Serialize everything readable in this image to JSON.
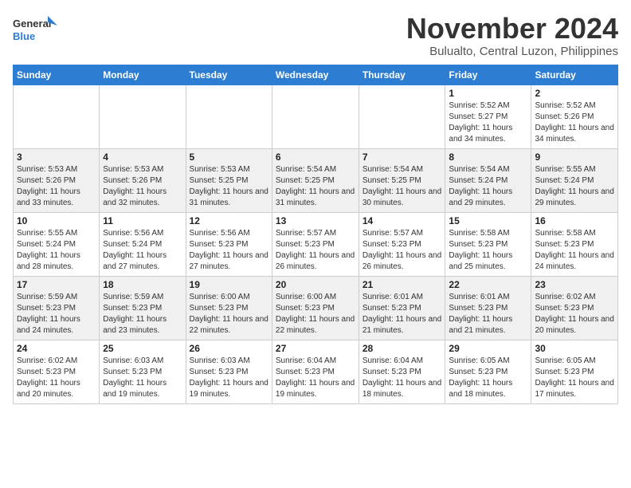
{
  "logo": {
    "line1": "General",
    "line2": "Blue"
  },
  "header": {
    "month": "November 2024",
    "location": "Bulualto, Central Luzon, Philippines"
  },
  "weekdays": [
    "Sunday",
    "Monday",
    "Tuesday",
    "Wednesday",
    "Thursday",
    "Friday",
    "Saturday"
  ],
  "weeks": [
    [
      {
        "day": "",
        "info": ""
      },
      {
        "day": "",
        "info": ""
      },
      {
        "day": "",
        "info": ""
      },
      {
        "day": "",
        "info": ""
      },
      {
        "day": "",
        "info": ""
      },
      {
        "day": "1",
        "info": "Sunrise: 5:52 AM\nSunset: 5:27 PM\nDaylight: 11 hours and 34 minutes."
      },
      {
        "day": "2",
        "info": "Sunrise: 5:52 AM\nSunset: 5:26 PM\nDaylight: 11 hours and 34 minutes."
      }
    ],
    [
      {
        "day": "3",
        "info": "Sunrise: 5:53 AM\nSunset: 5:26 PM\nDaylight: 11 hours and 33 minutes."
      },
      {
        "day": "4",
        "info": "Sunrise: 5:53 AM\nSunset: 5:26 PM\nDaylight: 11 hours and 32 minutes."
      },
      {
        "day": "5",
        "info": "Sunrise: 5:53 AM\nSunset: 5:25 PM\nDaylight: 11 hours and 31 minutes."
      },
      {
        "day": "6",
        "info": "Sunrise: 5:54 AM\nSunset: 5:25 PM\nDaylight: 11 hours and 31 minutes."
      },
      {
        "day": "7",
        "info": "Sunrise: 5:54 AM\nSunset: 5:25 PM\nDaylight: 11 hours and 30 minutes."
      },
      {
        "day": "8",
        "info": "Sunrise: 5:54 AM\nSunset: 5:24 PM\nDaylight: 11 hours and 29 minutes."
      },
      {
        "day": "9",
        "info": "Sunrise: 5:55 AM\nSunset: 5:24 PM\nDaylight: 11 hours and 29 minutes."
      }
    ],
    [
      {
        "day": "10",
        "info": "Sunrise: 5:55 AM\nSunset: 5:24 PM\nDaylight: 11 hours and 28 minutes."
      },
      {
        "day": "11",
        "info": "Sunrise: 5:56 AM\nSunset: 5:24 PM\nDaylight: 11 hours and 27 minutes."
      },
      {
        "day": "12",
        "info": "Sunrise: 5:56 AM\nSunset: 5:23 PM\nDaylight: 11 hours and 27 minutes."
      },
      {
        "day": "13",
        "info": "Sunrise: 5:57 AM\nSunset: 5:23 PM\nDaylight: 11 hours and 26 minutes."
      },
      {
        "day": "14",
        "info": "Sunrise: 5:57 AM\nSunset: 5:23 PM\nDaylight: 11 hours and 26 minutes."
      },
      {
        "day": "15",
        "info": "Sunrise: 5:58 AM\nSunset: 5:23 PM\nDaylight: 11 hours and 25 minutes."
      },
      {
        "day": "16",
        "info": "Sunrise: 5:58 AM\nSunset: 5:23 PM\nDaylight: 11 hours and 24 minutes."
      }
    ],
    [
      {
        "day": "17",
        "info": "Sunrise: 5:59 AM\nSunset: 5:23 PM\nDaylight: 11 hours and 24 minutes."
      },
      {
        "day": "18",
        "info": "Sunrise: 5:59 AM\nSunset: 5:23 PM\nDaylight: 11 hours and 23 minutes."
      },
      {
        "day": "19",
        "info": "Sunrise: 6:00 AM\nSunset: 5:23 PM\nDaylight: 11 hours and 22 minutes."
      },
      {
        "day": "20",
        "info": "Sunrise: 6:00 AM\nSunset: 5:23 PM\nDaylight: 11 hours and 22 minutes."
      },
      {
        "day": "21",
        "info": "Sunrise: 6:01 AM\nSunset: 5:23 PM\nDaylight: 11 hours and 21 minutes."
      },
      {
        "day": "22",
        "info": "Sunrise: 6:01 AM\nSunset: 5:23 PM\nDaylight: 11 hours and 21 minutes."
      },
      {
        "day": "23",
        "info": "Sunrise: 6:02 AM\nSunset: 5:23 PM\nDaylight: 11 hours and 20 minutes."
      }
    ],
    [
      {
        "day": "24",
        "info": "Sunrise: 6:02 AM\nSunset: 5:23 PM\nDaylight: 11 hours and 20 minutes."
      },
      {
        "day": "25",
        "info": "Sunrise: 6:03 AM\nSunset: 5:23 PM\nDaylight: 11 hours and 19 minutes."
      },
      {
        "day": "26",
        "info": "Sunrise: 6:03 AM\nSunset: 5:23 PM\nDaylight: 11 hours and 19 minutes."
      },
      {
        "day": "27",
        "info": "Sunrise: 6:04 AM\nSunset: 5:23 PM\nDaylight: 11 hours and 19 minutes."
      },
      {
        "day": "28",
        "info": "Sunrise: 6:04 AM\nSunset: 5:23 PM\nDaylight: 11 hours and 18 minutes."
      },
      {
        "day": "29",
        "info": "Sunrise: 6:05 AM\nSunset: 5:23 PM\nDaylight: 11 hours and 18 minutes."
      },
      {
        "day": "30",
        "info": "Sunrise: 6:05 AM\nSunset: 5:23 PM\nDaylight: 11 hours and 17 minutes."
      }
    ]
  ]
}
